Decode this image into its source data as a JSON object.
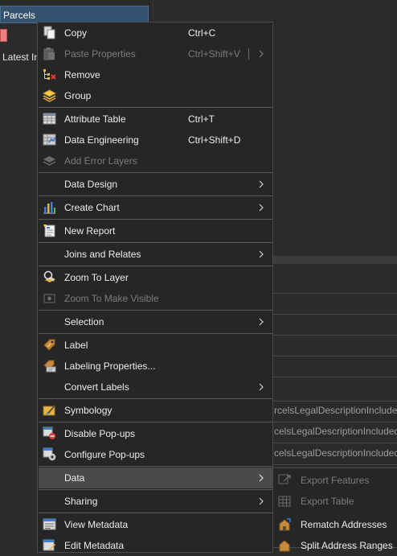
{
  "contents": {
    "layer_name": "Parcels",
    "second_layer": "Latest In",
    "swatch_color": "#f08080"
  },
  "background_table": {
    "cells": [
      "rcelsLegalDescriptionIncluded.",
      "celsLegalDescriptionIncluded.",
      "celsLegalDescriptionIncluded."
    ]
  },
  "context_menu": {
    "items": [
      {
        "label": "Copy",
        "shortcut": "Ctrl+C",
        "icon": "copy-icon",
        "enabled": true
      },
      {
        "label": "Paste Properties",
        "shortcut": "Ctrl+Shift+V",
        "icon": "paste-properties-icon",
        "enabled": false,
        "submenu": true
      },
      {
        "label": "Remove",
        "icon": "remove-icon",
        "enabled": true
      },
      {
        "label": "Group",
        "icon": "group-layers-icon",
        "enabled": true
      },
      {
        "label": "Attribute Table",
        "shortcut": "Ctrl+T",
        "icon": "attribute-table-icon",
        "enabled": true
      },
      {
        "label": "Data Engineering",
        "shortcut": "Ctrl+Shift+D",
        "icon": "data-engineering-icon",
        "enabled": true
      },
      {
        "label": "Add Error Layers",
        "icon": "add-error-layers-icon",
        "enabled": false
      },
      {
        "label": "Data Design",
        "enabled": true,
        "submenu": true
      },
      {
        "label": "Create Chart",
        "icon": "chart-icon",
        "enabled": true,
        "submenu": true
      },
      {
        "label": "New Report",
        "icon": "report-icon",
        "enabled": true
      },
      {
        "label": "Joins and Relates",
        "enabled": true,
        "submenu": true
      },
      {
        "label": "Zoom To Layer",
        "icon": "zoom-to-layer-icon",
        "enabled": true
      },
      {
        "label": "Zoom To Make Visible",
        "icon": "zoom-visible-icon",
        "enabled": false
      },
      {
        "label": "Selection",
        "enabled": true,
        "submenu": true
      },
      {
        "label": "Label",
        "icon": "label-icon",
        "enabled": true
      },
      {
        "label": "Labeling Properties...",
        "icon": "labeling-properties-icon",
        "enabled": true
      },
      {
        "label": "Convert Labels",
        "enabled": true,
        "submenu": true
      },
      {
        "label": "Symbology",
        "icon": "symbology-icon",
        "enabled": true
      },
      {
        "label": "Disable Pop-ups",
        "icon": "disable-popups-icon",
        "enabled": true
      },
      {
        "label": "Configure Pop-ups",
        "icon": "configure-popups-icon",
        "enabled": true
      },
      {
        "label": "Data",
        "enabled": true,
        "submenu": true,
        "highlighted": true
      },
      {
        "label": "Sharing",
        "enabled": true,
        "submenu": true
      },
      {
        "label": "View Metadata",
        "icon": "metadata-icon",
        "enabled": true
      },
      {
        "label": "Edit Metadata",
        "icon": "edit-metadata-icon",
        "enabled": true
      }
    ]
  },
  "data_submenu": {
    "items": [
      {
        "label": "Export Features",
        "icon": "export-features-icon",
        "enabled": false
      },
      {
        "label": "Export Table",
        "icon": "export-table-icon",
        "enabled": false
      },
      {
        "label": "Rematch Addresses",
        "icon": "rematch-addresses-icon",
        "enabled": true
      },
      {
        "label": "Split Address Ranges",
        "icon": "split-address-icon",
        "enabled": true
      }
    ]
  },
  "colors": {
    "menu_bg": "#262626",
    "highlight": "#4a4a4a",
    "selected_layer": "#35536f",
    "text": "#ececec",
    "disabled_text": "#7c7c7c"
  }
}
